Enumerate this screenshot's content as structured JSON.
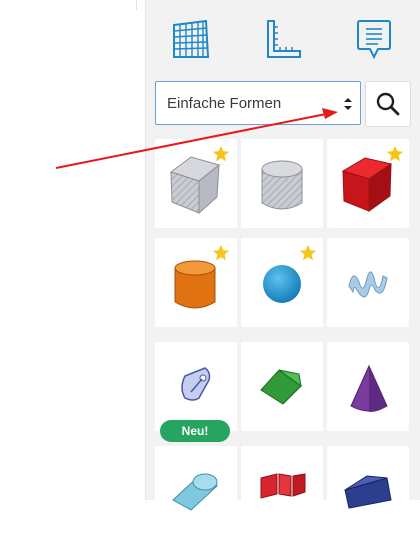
{
  "toolbar": {
    "icons": [
      "grid-icon",
      "ruler-icon",
      "notes-icon"
    ]
  },
  "shape_picker": {
    "selected_category": "Einfache Formen",
    "search_icon": "search-icon"
  },
  "shapes": [
    {
      "name": "box",
      "favorite": true
    },
    {
      "name": "cylinder-hole",
      "favorite": false
    },
    {
      "name": "box-red",
      "favorite": true
    },
    {
      "name": "cylinder",
      "favorite": true
    },
    {
      "name": "sphere",
      "favorite": true
    },
    {
      "name": "scribble",
      "favorite": false
    },
    {
      "name": "shape-generator",
      "favorite": false,
      "badge": "Neu!"
    },
    {
      "name": "roof",
      "favorite": false
    },
    {
      "name": "cone",
      "favorite": false
    },
    {
      "name": "round-roof",
      "favorite": false
    },
    {
      "name": "text",
      "favorite": false
    },
    {
      "name": "wedge",
      "favorite": false
    }
  ],
  "colors": {
    "accent": "#6aa0d8",
    "star": "#f5c518",
    "badge": "#25a55f",
    "annotation_arrow": "#e8191a"
  }
}
